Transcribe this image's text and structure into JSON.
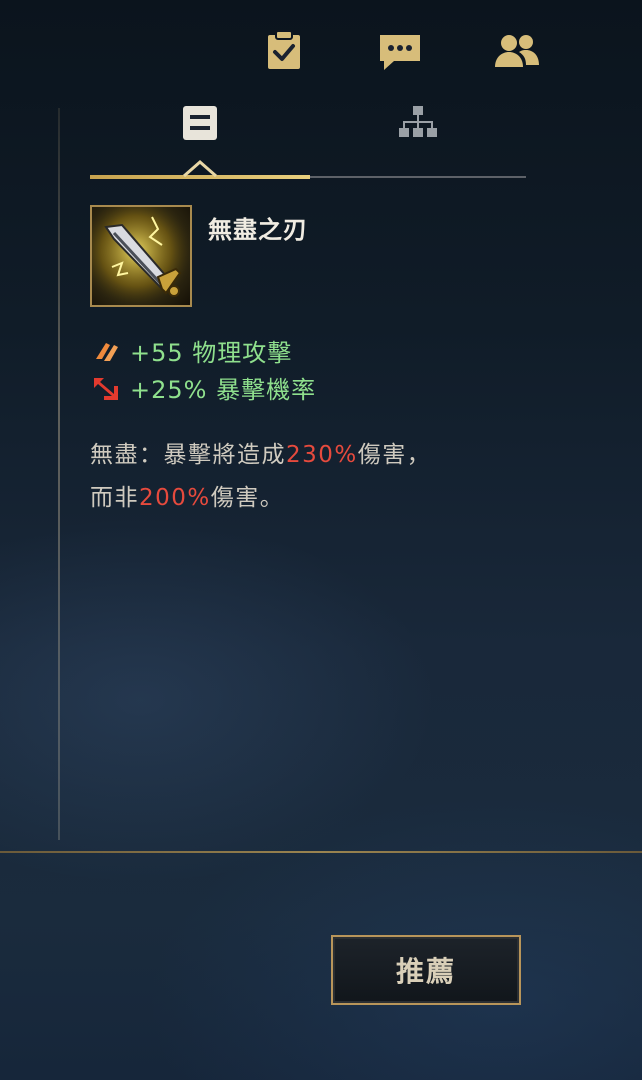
{
  "top_bar": {
    "icons": [
      "clipboard-check-icon",
      "chat-icon",
      "friends-icon"
    ]
  },
  "tabs": [
    {
      "icon": "item-details-icon",
      "active": true
    },
    {
      "icon": "build-tree-icon",
      "active": false
    }
  ],
  "item": {
    "name": "無盡之刃",
    "icon": "infinity-edge-sword-icon",
    "stats": [
      {
        "icon": "attack-damage-icon",
        "text": "+55 物理攻擊"
      },
      {
        "icon": "crit-chance-icon",
        "text": "+25% 暴擊機率"
      }
    ],
    "passive": {
      "line1_prefix": "無盡：暴擊將造成",
      "line1_value": "230%",
      "line1_suffix": "傷害，",
      "line2_prefix": "而非",
      "line2_value": "200%",
      "line2_suffix": "傷害。"
    }
  },
  "recommend_button": "推薦",
  "colors": {
    "gold": "#c8aa6e",
    "stat_green": "#8fe08d",
    "highlight_red": "#e64a3d",
    "text": "#cfcabf"
  }
}
